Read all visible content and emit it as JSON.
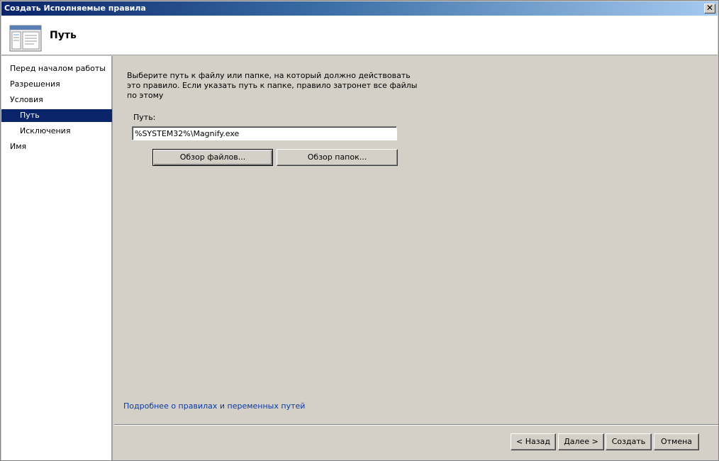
{
  "window": {
    "title": "Создать Исполняемые правила",
    "close_label": "✕"
  },
  "header": {
    "page_title": "Путь",
    "icon": "wizard-page-icon"
  },
  "sidebar": {
    "items": [
      {
        "label": "Перед началом работы"
      },
      {
        "label": "Разрешения"
      },
      {
        "label": "Условия"
      },
      {
        "label": "Путь",
        "selected": true
      },
      {
        "label": "Исключения"
      },
      {
        "label": "Имя"
      }
    ]
  },
  "main": {
    "instruction": "Выберите путь к файлу или папке, на который должно действовать это правило. Если указать путь к папке, правило затронет все файлы по этому",
    "path_label": "Путь:",
    "path_value": "%SYSTEM32%\\Magnify.exe",
    "browse_files_label": "Обзор файлов...",
    "browse_folders_label": "Обзор папок...",
    "help_link": "Подробнее о правилах и переменных путей"
  },
  "footer": {
    "back_label": "< Назад",
    "next_label": "Далее >",
    "create_label": "Создать",
    "cancel_label": "Отмена"
  },
  "colors": {
    "selection": "#0a246a",
    "link": "#0b3a9e",
    "face": "#d4d0c8"
  }
}
